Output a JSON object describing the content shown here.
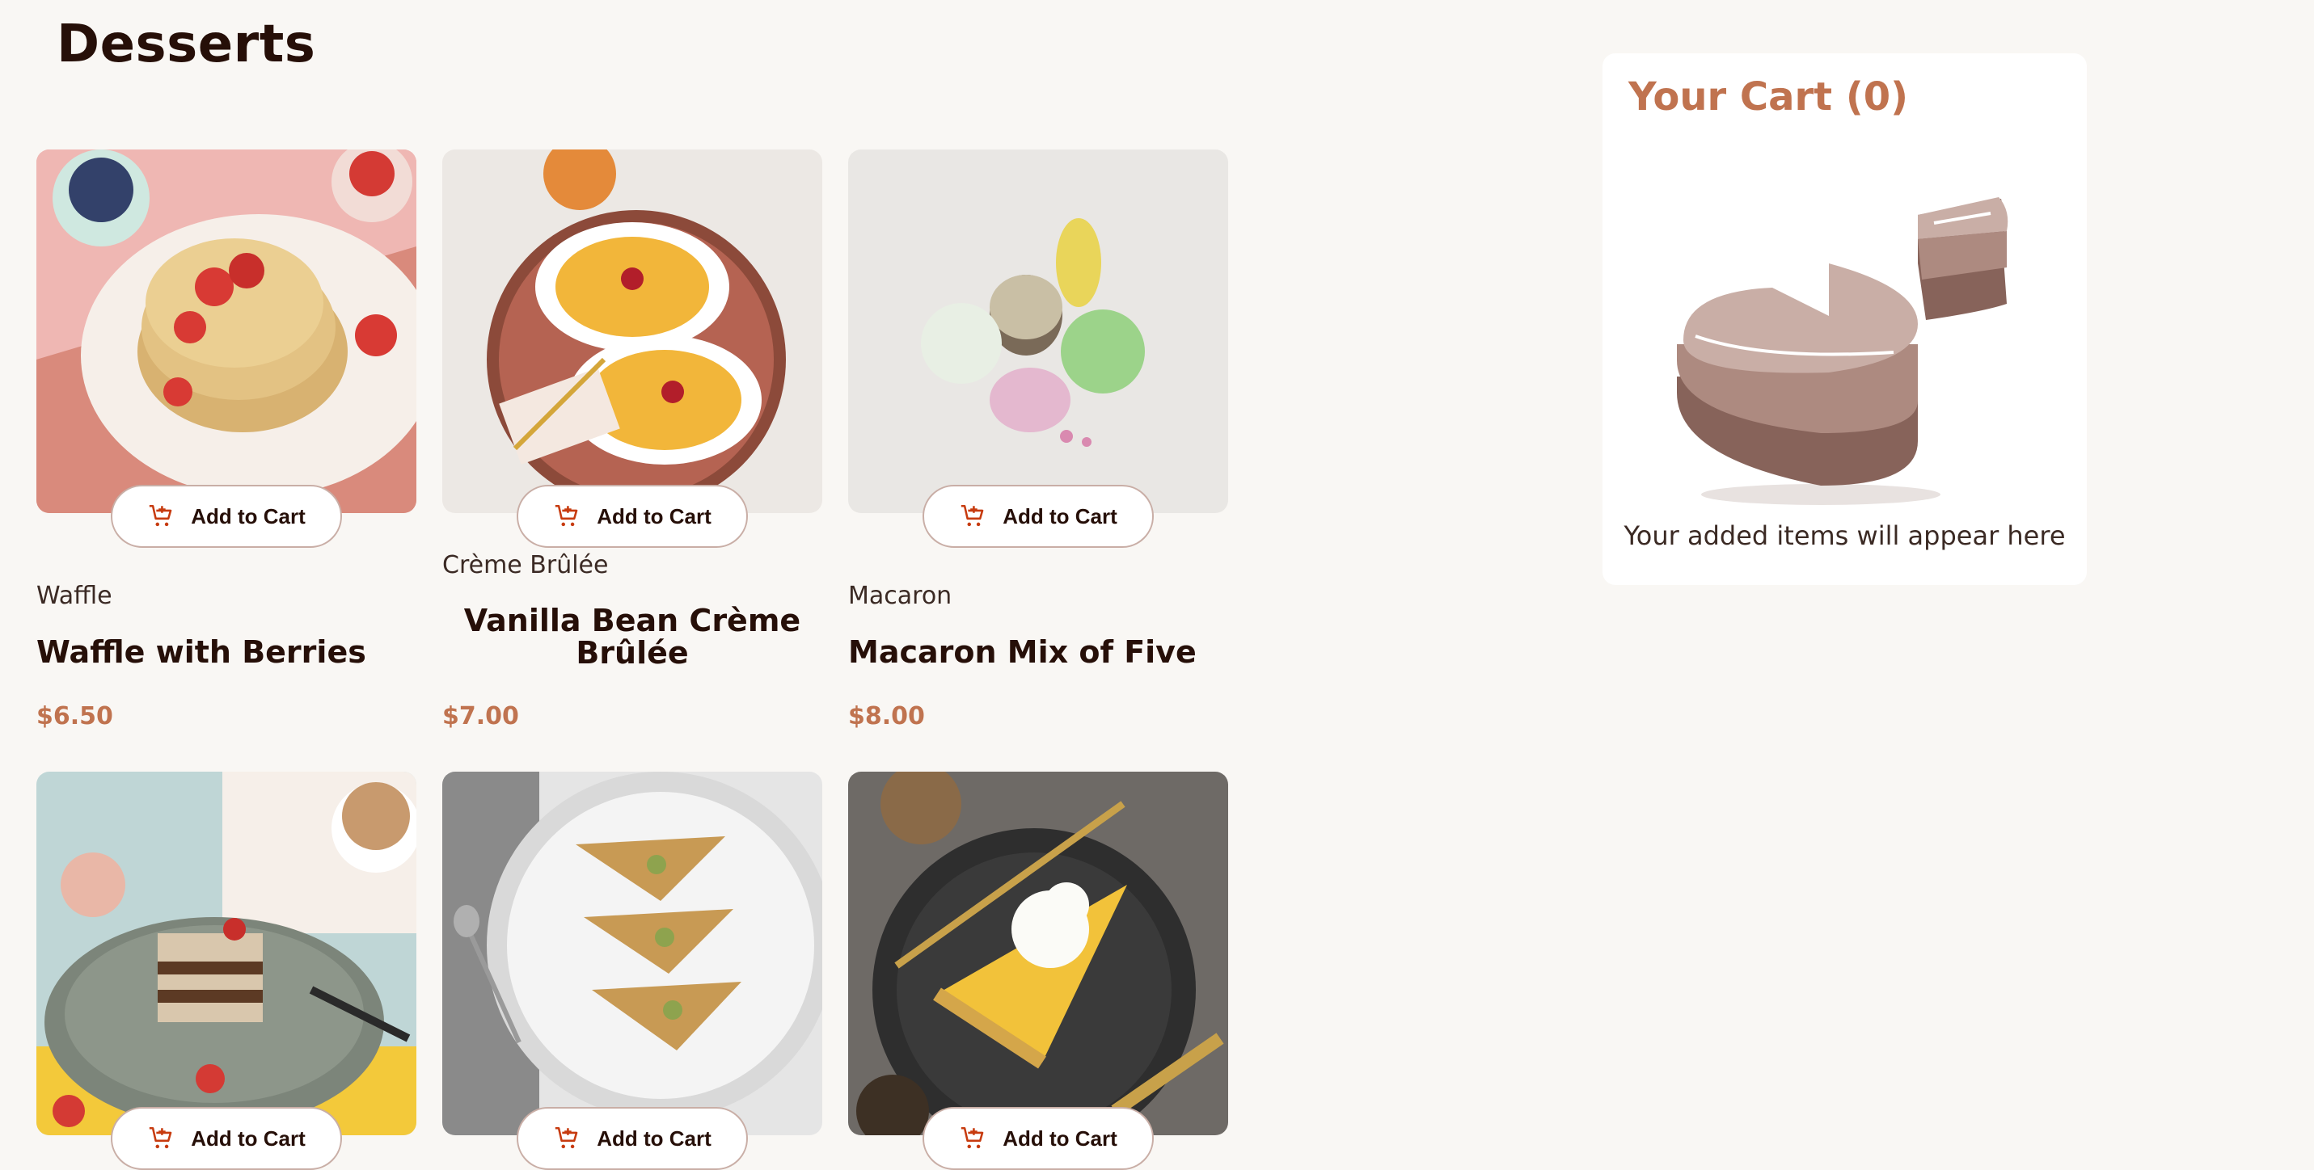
{
  "page": {
    "title": "Desserts"
  },
  "products": [
    {
      "category": "Waffle",
      "name": "Waffle with Berries",
      "price": "$6.50",
      "add_label": "Add to Cart"
    },
    {
      "category": "Crème Brûlée",
      "name": "Vanilla Bean Crème Brûlée",
      "price": "$7.00",
      "add_label": "Add to Cart"
    },
    {
      "category": "Macaron",
      "name": "Macaron Mix of Five",
      "price": "$8.00",
      "add_label": "Add to Cart"
    },
    {
      "add_label": "Add to Cart"
    },
    {
      "add_label": "Add to Cart"
    },
    {
      "add_label": "Add to Cart"
    }
  ],
  "cart": {
    "title": "Your Cart (0)",
    "empty_text": "Your added items will appear here"
  },
  "colors": {
    "accent": "#c0734f",
    "text_dark": "#260f08",
    "background": "#f9f7f4",
    "border": "#c9aea6"
  },
  "icons": {
    "add_to_cart": "cart-add-icon",
    "empty_cart": "cake-illustration"
  }
}
